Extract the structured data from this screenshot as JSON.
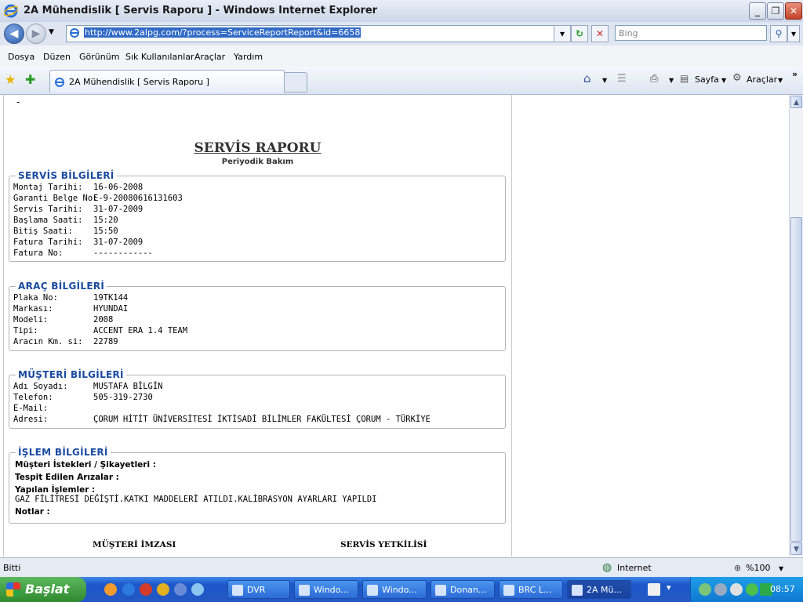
{
  "window": {
    "title": "2A Mühendislik [ Servis Raporu ] - Windows Internet Explorer"
  },
  "address": {
    "url": "http://www.2alpg.com/?process=ServiceReportReport&id=6658",
    "search_placeholder": "Bing"
  },
  "menu": [
    "Dosya",
    "Düzen",
    "Görünüm",
    "Sık Kullanılanlar",
    "Araçlar",
    "Yardım"
  ],
  "tab": {
    "label": "2A Mühendislik [ Servis Raporu ]"
  },
  "commands": {
    "page": "Sayfa",
    "tools": "Araçlar"
  },
  "report": {
    "dash": "-",
    "title": "SERVİS RAPORU",
    "subtitle": "Periyodik Bakım",
    "service": {
      "legend": "SERVİS BİLGİLERİ",
      "rows": [
        {
          "k": "Montaj Tarihi:",
          "v": "16-06-2008"
        },
        {
          "k": "Garanti Belge No:",
          "v": "E-9-20080616131603"
        },
        {
          "k": "Servis Tarihi:",
          "v": "31-07-2009"
        },
        {
          "k": "Başlama Saati:",
          "v": "15:20"
        },
        {
          "k": "Bitiş Saati:",
          "v": "15:50"
        },
        {
          "k": "Fatura Tarihi:",
          "v": "31-07-2009"
        },
        {
          "k": "Fatura No:",
          "v": "------------"
        }
      ]
    },
    "vehicle": {
      "legend": "ARAÇ BİLGİLERİ",
      "rows": [
        {
          "k": "Plaka No:",
          "v": "19TK144"
        },
        {
          "k": "Markası:",
          "v": "HYUNDAI"
        },
        {
          "k": "Modeli:",
          "v": "2008"
        },
        {
          "k": "Tipi:",
          "v": "ACCENT ERA 1.4 TEAM"
        },
        {
          "k": "Aracın Km. si:",
          "v": "22789"
        }
      ]
    },
    "customer": {
      "legend": "MÜŞTERİ BİLGİLERİ",
      "rows": [
        {
          "k": "Adı Soyadı:",
          "v": "MUSTAFA BİLGİN"
        },
        {
          "k": "Telefon:",
          "v": "505-319-2730"
        },
        {
          "k": "E-Mail:",
          "v": ""
        },
        {
          "k": "Adresi:",
          "v": "ÇORUM HİTİT ÜNİVERSİTESİ İKTİSADİ BİLİMLER FAKÜLTESİ ÇORUM - TÜRKİYE"
        }
      ]
    },
    "operation": {
      "legend": "İŞLEM BİLGİLERİ",
      "requests": "Müşteri İstekleri / Şikayetleri :",
      "faults": "Tespit Edilen Arızalar :",
      "done_label": "Yapılan İşlemler :",
      "done_text": "GAZ FİLİTRESİ DEĞİŞTİ.KATKI MADDELERİ ATILDI.KALİBRASYON AYARLARI YAPILDI",
      "notes": "Notlar :"
    },
    "signatures": {
      "customer": "MÜŞTERİ İMZASI",
      "service": "SERVİS YETKİLİSİ"
    }
  },
  "status": {
    "text": "Bitti",
    "zone": "Internet",
    "zoom": "%100"
  },
  "taskbar": {
    "start": "Başlat",
    "tasks": [
      "DVR",
      "Windo...",
      "Windo...",
      "Donan...",
      "BRC L...",
      "2A Mü..."
    ],
    "clock": "08:57"
  }
}
